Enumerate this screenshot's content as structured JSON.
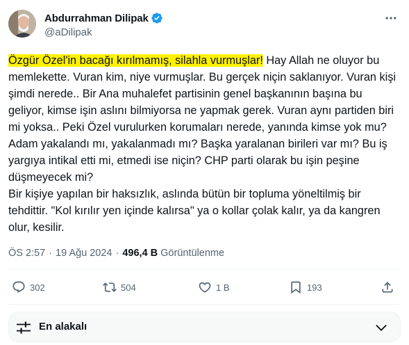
{
  "author": {
    "display_name": "Abdurrahman Dilipak",
    "handle": "@aDilipak",
    "verified": true
  },
  "tweet": {
    "highlight": "Özgür Özel'in bacağı kırılmamış, silahla vurmuşlar!",
    "text_rest": " Hay Allah ne oluyor bu memlekette. Vuran kim, niye vurmuşlar. Bu gerçek niçin saklanıyor. Vuran kişi şimdi nerede.. Bir Ana muhalefet partisinin genel başkanının başına bu geliyor, kimse işin aslını bilmiyorsa ne yapmak gerek. Vuran aynı partiden biri mi yoksa.. Peki Özel vurulurken korumaları nerede, yanında kimse yok mu? Adam yakalandı mı, yakalanmadı mı? Başka yaralanan birileri var mı? Bu iş yargıya intikal etti mi, etmedi ise niçin? CHP parti olarak bu işin peşine düşmeyecek mi?\nBir kişiye yapılan bir haksızlık, aslında bütün bir topluma yöneltilmiş bir tehdittir. \"Kol kırılır yen içinde kalırsa\" ya o kollar çolak kalır, ya da kangren olur, kesilir.",
    "highlight_color": "#fff200"
  },
  "meta": {
    "time": "ÖS 2:57",
    "separator": "·",
    "date": "19 Ağu 2024",
    "views_count": "496,4 B",
    "views_label": "Görüntülenme"
  },
  "actions": {
    "replies": "302",
    "reposts": "504",
    "likes": "1 B",
    "bookmarks": "193"
  },
  "sort": {
    "label": "En alakalı"
  },
  "colors": {
    "verified": "#1d9bf0",
    "muted": "#536471",
    "text": "#0f1419"
  }
}
